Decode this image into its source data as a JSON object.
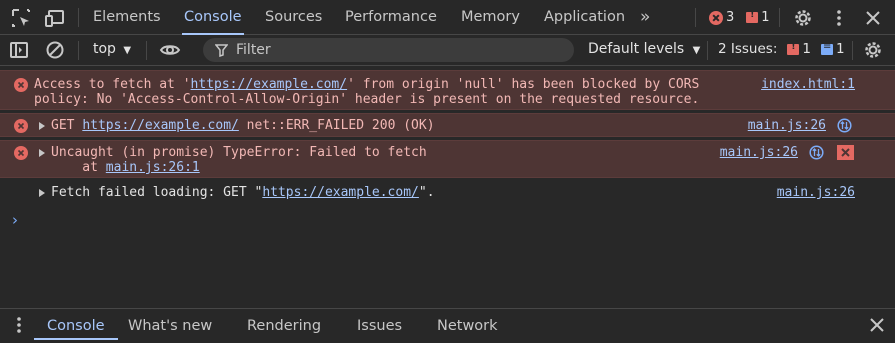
{
  "top_tabs": [
    {
      "label": "Elements",
      "active": false
    },
    {
      "label": "Console",
      "active": true
    },
    {
      "label": "Sources",
      "active": false
    },
    {
      "label": "Performance",
      "active": false
    },
    {
      "label": "Memory",
      "active": false
    },
    {
      "label": "Application",
      "active": false
    }
  ],
  "status": {
    "errors": "3",
    "issues": "1"
  },
  "toolbar": {
    "context": "top",
    "filter_placeholder": "Filter",
    "levels": "Default levels",
    "issues_label": "2 Issues:",
    "issues_error_count": "1",
    "issues_info_count": "1"
  },
  "messages": [
    {
      "type": "error",
      "line1_pre": "Access to fetch at '",
      "line1_link": "https://example.com/",
      "line1_post": "' from origin 'null' has been blocked by CORS",
      "line2": "policy: No 'Access-Control-Allow-Origin' header is present on the requested resource.",
      "source": "index.html:1"
    },
    {
      "type": "error",
      "pre": "GET ",
      "link": "https://example.com/",
      "post": " net::ERR_FAILED 200 (OK)",
      "source": "main.js:26"
    },
    {
      "type": "error",
      "line1": "Uncaught (in promise) TypeError: Failed to fetch",
      "line2_pre": "    at ",
      "line2_link": "main.js:26:1",
      "source": "main.js:26"
    },
    {
      "type": "info",
      "pre": "Fetch failed loading: GET \"",
      "link": "https://example.com/",
      "post": "\".",
      "source": "main.js:26"
    }
  ],
  "drawer_tabs": [
    {
      "label": "Console",
      "active": true
    },
    {
      "label": "What's new",
      "active": false
    },
    {
      "label": "Rendering",
      "active": false
    },
    {
      "label": "Issues",
      "active": false
    },
    {
      "label": "Network",
      "active": false
    }
  ],
  "colors": {
    "accent": "#a8c7fa",
    "error_bg": "#4e3534",
    "error_text": "#f2b8b5",
    "error_icon": "#e46962",
    "background": "#282828"
  }
}
